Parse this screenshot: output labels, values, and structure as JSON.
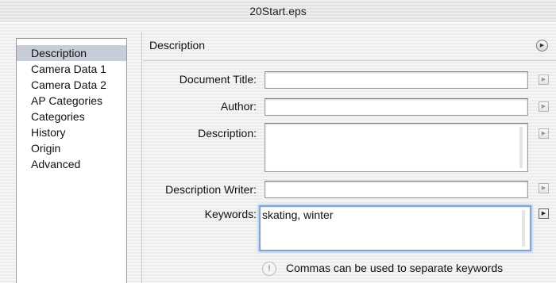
{
  "window": {
    "title": "20Start.eps"
  },
  "sidebar": {
    "items": [
      {
        "label": "Description",
        "selected": true
      },
      {
        "label": "Camera Data 1",
        "selected": false
      },
      {
        "label": "Camera Data 2",
        "selected": false
      },
      {
        "label": "AP Categories",
        "selected": false
      },
      {
        "label": "Categories",
        "selected": false
      },
      {
        "label": "History",
        "selected": false
      },
      {
        "label": "Origin",
        "selected": false
      },
      {
        "label": "Advanced",
        "selected": false
      }
    ]
  },
  "panel": {
    "title": "Description",
    "menu_icon": "circle-arrow-icon",
    "fields": {
      "document_title": {
        "label": "Document Title:",
        "value": ""
      },
      "author": {
        "label": "Author:",
        "value": ""
      },
      "description": {
        "label": "Description:",
        "value": ""
      },
      "description_writer": {
        "label": "Description Writer:",
        "value": ""
      },
      "keywords": {
        "label": "Keywords:",
        "value": "skating, winter"
      }
    },
    "hint": {
      "icon": "info-icon",
      "icon_glyph": "!",
      "text": "Commas can be used to separate keywords"
    }
  },
  "colors": {
    "selection": "#c6ccd8",
    "focus_ring": "#7fa6d6"
  }
}
